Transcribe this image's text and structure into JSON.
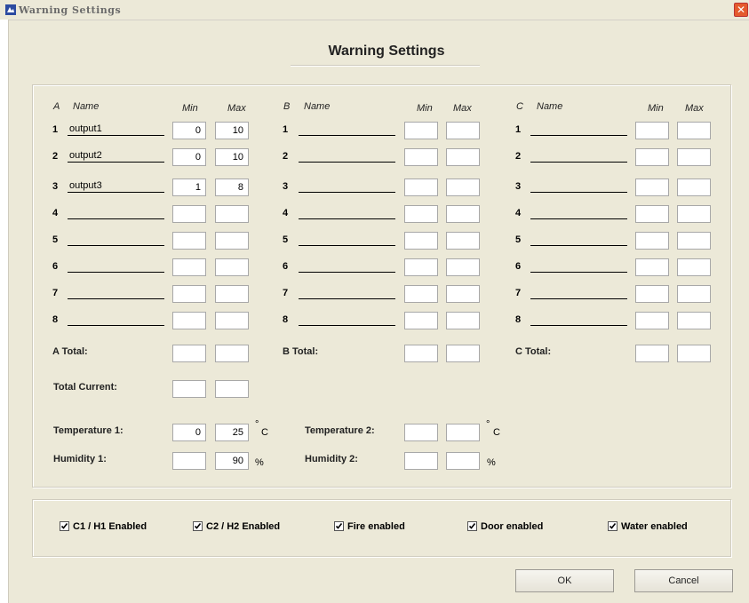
{
  "window": {
    "title": "Warning Settings",
    "close_glyph": "✕"
  },
  "header": {
    "title": "Warning Settings"
  },
  "groups": [
    {
      "letter": "A",
      "name_label": "Name",
      "min_label": "Min",
      "max_label": "Max",
      "total_label": "A Total:",
      "total_min": "",
      "total_max": "",
      "rows": [
        {
          "num": "1",
          "name": "output1",
          "min": "0",
          "max": "10"
        },
        {
          "num": "2",
          "name": "output2",
          "min": "0",
          "max": "10"
        },
        {
          "num": "3",
          "name": "output3",
          "min": "1",
          "max": "8"
        },
        {
          "num": "4",
          "name": "",
          "min": "",
          "max": ""
        },
        {
          "num": "5",
          "name": "",
          "min": "",
          "max": ""
        },
        {
          "num": "6",
          "name": "",
          "min": "",
          "max": ""
        },
        {
          "num": "7",
          "name": "",
          "min": "",
          "max": ""
        },
        {
          "num": "8",
          "name": "",
          "min": "",
          "max": ""
        }
      ]
    },
    {
      "letter": "B",
      "name_label": "Name",
      "min_label": "Min",
      "max_label": "Max",
      "total_label": "B Total:",
      "total_min": "",
      "total_max": "",
      "rows": [
        {
          "num": "1",
          "name": "",
          "min": "",
          "max": ""
        },
        {
          "num": "2",
          "name": "",
          "min": "",
          "max": ""
        },
        {
          "num": "3",
          "name": "",
          "min": "",
          "max": ""
        },
        {
          "num": "4",
          "name": "",
          "min": "",
          "max": ""
        },
        {
          "num": "5",
          "name": "",
          "min": "",
          "max": ""
        },
        {
          "num": "6",
          "name": "",
          "min": "",
          "max": ""
        },
        {
          "num": "7",
          "name": "",
          "min": "",
          "max": ""
        },
        {
          "num": "8",
          "name": "",
          "min": "",
          "max": ""
        }
      ]
    },
    {
      "letter": "C",
      "name_label": "Name",
      "min_label": "Min",
      "max_label": "Max",
      "total_label": "C Total:",
      "total_min": "",
      "total_max": "",
      "rows": [
        {
          "num": "1",
          "name": "",
          "min": "",
          "max": ""
        },
        {
          "num": "2",
          "name": "",
          "min": "",
          "max": ""
        },
        {
          "num": "3",
          "name": "",
          "min": "",
          "max": ""
        },
        {
          "num": "4",
          "name": "",
          "min": "",
          "max": ""
        },
        {
          "num": "5",
          "name": "",
          "min": "",
          "max": ""
        },
        {
          "num": "6",
          "name": "",
          "min": "",
          "max": ""
        },
        {
          "num": "7",
          "name": "",
          "min": "",
          "max": ""
        },
        {
          "num": "8",
          "name": "",
          "min": "",
          "max": ""
        }
      ]
    }
  ],
  "total_current": {
    "label": "Total Current:",
    "min": "",
    "max": ""
  },
  "temperature1": {
    "label": "Temperature 1:",
    "min": "0",
    "max": "25",
    "unit_deg": "°",
    "unit_c": "C"
  },
  "temperature2": {
    "label": "Temperature 2:",
    "min": "",
    "max": "",
    "unit_deg": "°",
    "unit_c": "C"
  },
  "humidity1": {
    "label": "Humidity 1:",
    "min": "",
    "max": "90",
    "unit": "%"
  },
  "humidity2": {
    "label": "Humidity 2:",
    "min": "",
    "max": "",
    "unit": "%"
  },
  "checkboxes": [
    {
      "label": "C1 / H1 Enabled",
      "checked": true
    },
    {
      "label": "C2 / H2 Enabled",
      "checked": true
    },
    {
      "label": "Fire enabled",
      "checked": true
    },
    {
      "label": "Door enabled",
      "checked": true
    },
    {
      "label": "Water enabled",
      "checked": true
    }
  ],
  "buttons": {
    "ok": "OK",
    "cancel": "Cancel"
  }
}
